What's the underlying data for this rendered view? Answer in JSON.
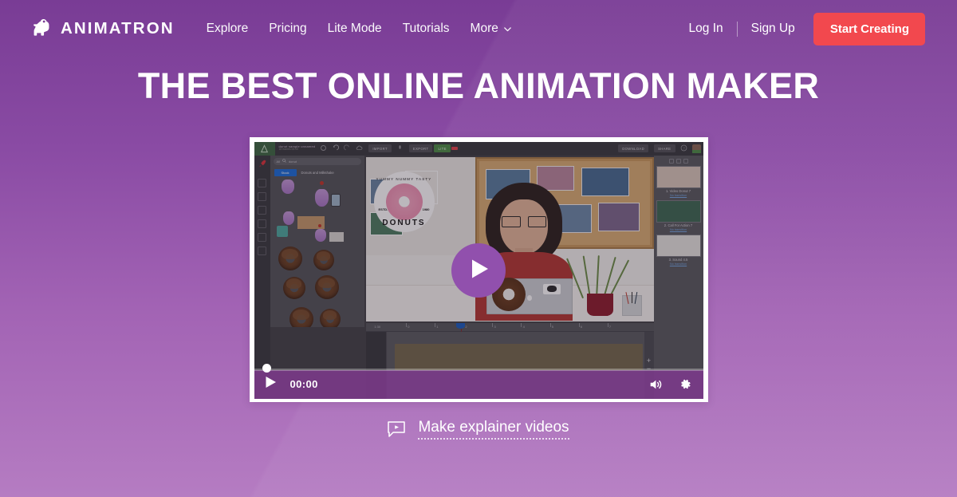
{
  "theme": {
    "bg_top": "#793c95",
    "bg_bottom": "#b57cc2",
    "header_bg": "#7b3f96",
    "cta_red": "#f2484e",
    "play_purple": "#9150ad",
    "control_bar": "rgba(125,58,140,0.86)"
  },
  "header": {
    "logo": {
      "icon": "animatron-dog-logo-icon",
      "wordmark": "ANIMATRON"
    },
    "nav_items": [
      {
        "label": "Explore",
        "name": "nav-explore"
      },
      {
        "label": "Pricing",
        "name": "nav-pricing"
      },
      {
        "label": "Lite Mode",
        "name": "nav-lite-mode"
      },
      {
        "label": "Tutorials",
        "name": "nav-tutorials"
      },
      {
        "label": "More",
        "name": "nav-more",
        "has_chevron": true
      }
    ],
    "login_label": "Log In",
    "signup_label": "Sign Up",
    "cta_label": "Start Creating"
  },
  "hero": {
    "headline": "THE BEST ONLINE ANIMATION MAKER"
  },
  "video": {
    "play_button_icon": "play-triangle-icon",
    "controls": {
      "play_icon": "play-icon",
      "time": "00:00",
      "volume_icon": "volume-on-icon",
      "settings_icon": "gear-icon",
      "progress_percent": 0
    },
    "editor": {
      "project_title": "donut sample unnamed",
      "project_sub": "18 frames  00:00",
      "toolbar_buttons": [
        "IMPORT",
        "EXPORT",
        "LITE",
        "DOWNLOAD",
        "SHARE"
      ],
      "library": {
        "search_placeholder": "donut",
        "search_scope": "All",
        "tab_active": "Stock",
        "tab_label": "Donuts and Milkshake"
      },
      "scenes": [
        {
          "index": "1.",
          "label": "1. Video Donut 7",
          "transition": "No transition"
        },
        {
          "index": "2.",
          "label": "2. Call For Action 7",
          "transition": "No transition"
        },
        {
          "index": "3.",
          "label": "3. Sound 4.5",
          "transition": "No transition"
        }
      ],
      "timeline_ticks": [
        "1:30",
        "0",
        "1",
        "2",
        "3",
        "4",
        "5",
        "6",
        "7"
      ],
      "zoom_in": "+",
      "zoom_out": "−"
    },
    "brand_logo": {
      "top_text": "YUMMY NUMMY TASTY",
      "bottom_text": "DONUTS",
      "estd": "ESTD.",
      "year": "1980"
    }
  },
  "bottom": {
    "icon": "video-message-icon",
    "link_label": "Make explainer videos"
  }
}
